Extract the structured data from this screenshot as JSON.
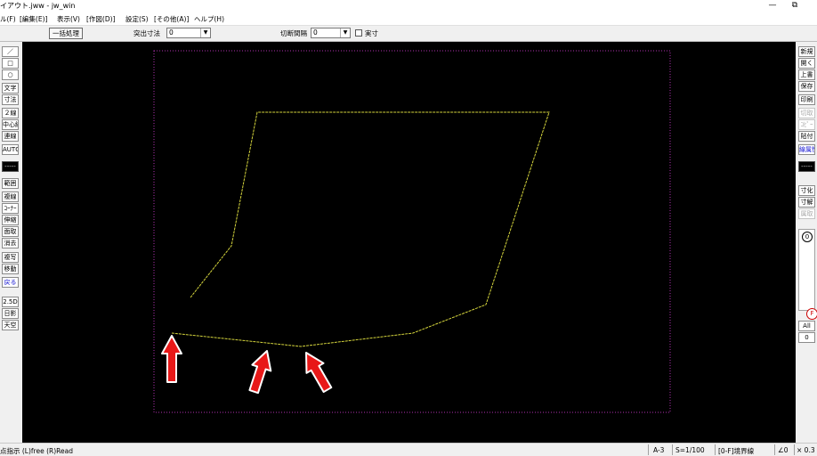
{
  "window": {
    "title": "イアウト.jww - jw_win",
    "minimize_glyph": "—",
    "restore_glyph": "⧉"
  },
  "menu": [
    "ル(F)",
    "[編集(E)]",
    "表示(V)",
    "[作図(D)]",
    "設定(S)",
    "[その他(A)]",
    "ヘルプ(H)"
  ],
  "toolbar": {
    "batch_button": "一括処理",
    "projection_label": "突出寸法",
    "projection_value": "0",
    "cut_interval_label": "切断間隔",
    "cut_interval_value": "0",
    "actual_size_label": "実寸"
  },
  "left_tools": {
    "line": "／",
    "rect": "□",
    "circle": "○",
    "text": "文字",
    "dimension": "寸法",
    "double_line": "２線",
    "center_line": "中心線",
    "continuous_line": "連線",
    "auto": "AUTO",
    "layer_indicator": "-----",
    "range": "範囲",
    "copy_line": "複線",
    "corner": "ｺｰﾅｰ",
    "stretch": "伸縮",
    "chamfer": "面取",
    "erase": "消去",
    "duplicate": "複写",
    "move": "移動",
    "undo": "戻る",
    "view_2_5d": "2.5D",
    "shadow": "日影",
    "sky": "天空"
  },
  "right_tools": {
    "new": "新規",
    "open": "開く",
    "overwrite": "上書",
    "save": "保存",
    "print": "印刷",
    "cut": "切取",
    "copy": "ｺﾋﾟｰ",
    "paste": "貼付",
    "layer_view": "線属性",
    "layer_indicator": "-----",
    "dim_transform": "寸化",
    "dim_explode": "寸解",
    "restore": "属取",
    "layer_group_zero": "0",
    "layer_group_f": "F",
    "all": "All",
    "zero": "0"
  },
  "status": {
    "message": "点指示 (L)free (R)Read",
    "paper": "A-3",
    "scale": "S=1/100",
    "layer": "[0-F]境界線",
    "angle": "∠0",
    "extra": "× 0.3"
  },
  "colors": {
    "canvas_bg": "#000000",
    "polyline": "#d4d43c",
    "paper_frame": "#b030b0",
    "arrow_fill": "#e81818",
    "arrow_stroke": "#ffffff"
  },
  "drawing": {
    "polyline_count": 2,
    "annotation_arrows": 3
  }
}
